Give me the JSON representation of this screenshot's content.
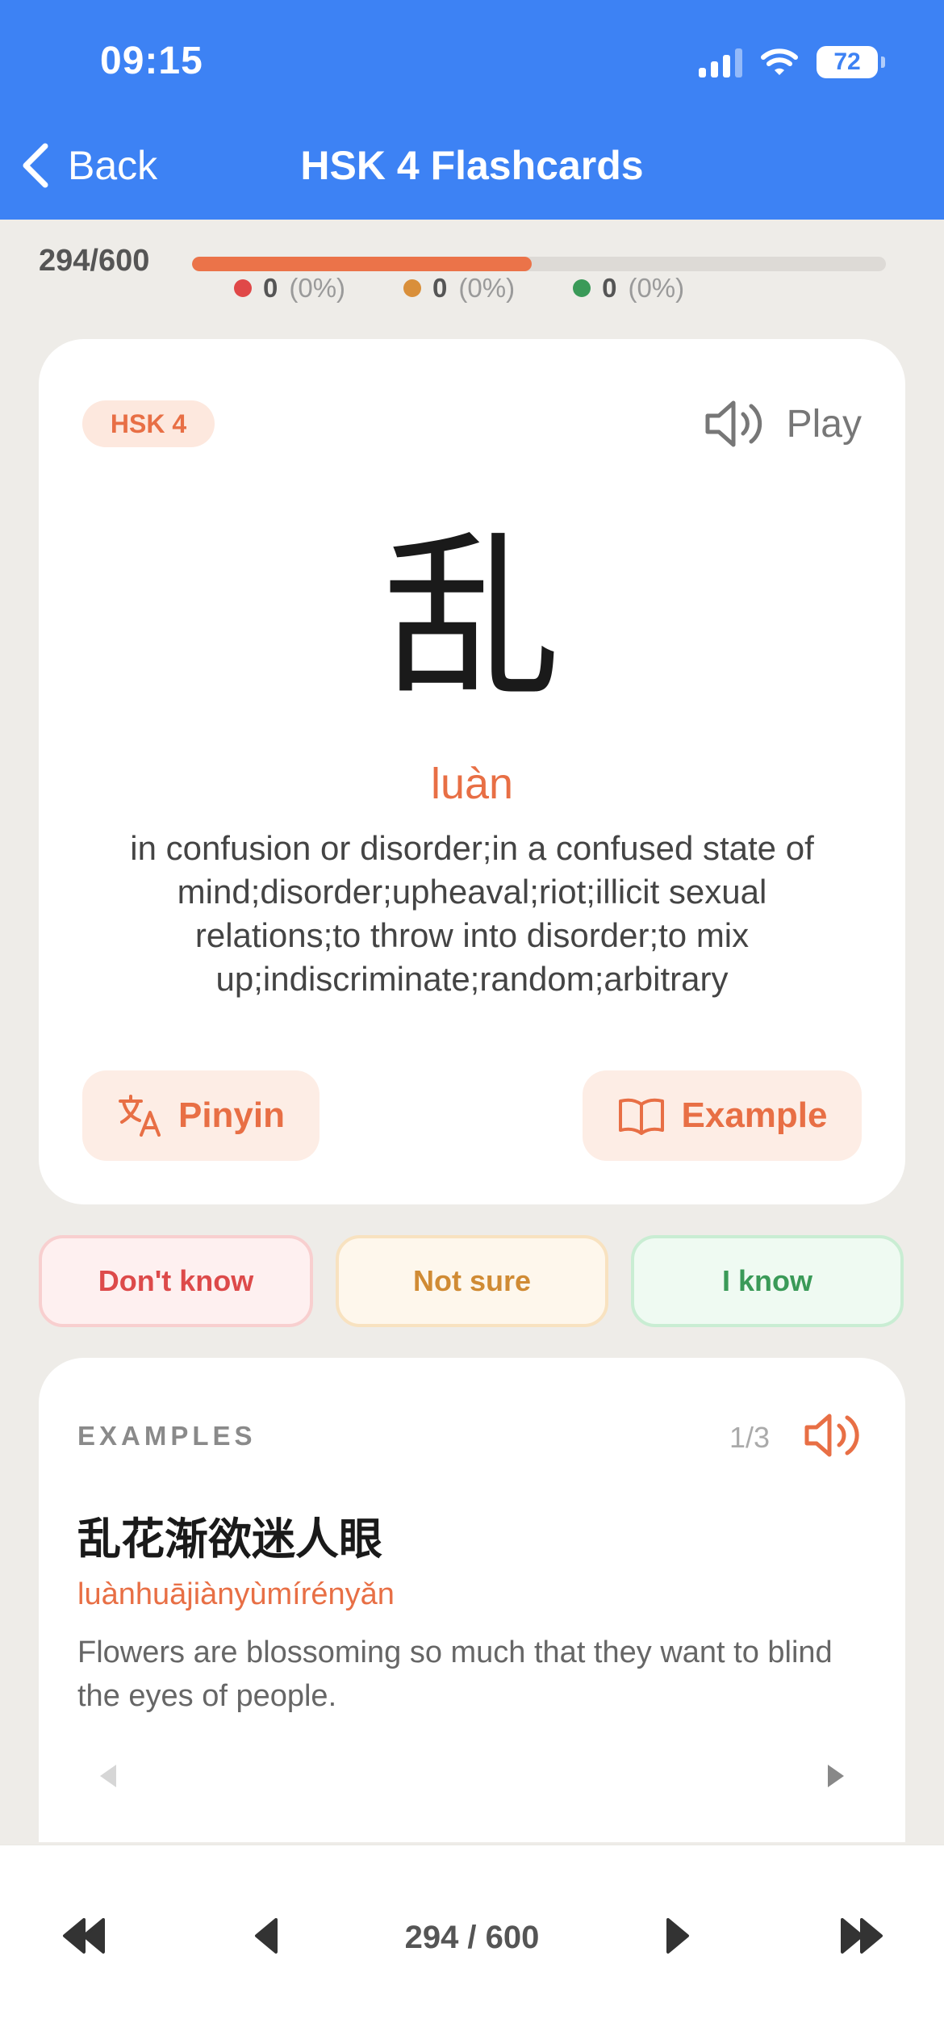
{
  "status_bar": {
    "time": "09:15",
    "battery": "72"
  },
  "header": {
    "back_label": "Back",
    "title": "HSK 4 Flashcards"
  },
  "progress": {
    "position_label": "294/600",
    "fraction": 0.49,
    "stats": [
      {
        "count": "0",
        "percent": "(0%)",
        "color": "#E04848"
      },
      {
        "count": "0",
        "percent": "(0%)",
        "color": "#D98F3A"
      },
      {
        "count": "0",
        "percent": "(0%)",
        "color": "#3A9A58"
      }
    ]
  },
  "card": {
    "level": "HSK 4",
    "play_label": "Play",
    "hanzi": "乱",
    "pinyin": "luàn",
    "meaning": "in confusion or disorder;in a confused state of mind;disorder;upheaval;riot;illicit sexual relations;to throw into disorder;to mix up;indiscriminate;random;arbitrary",
    "pinyin_button": "Pinyin",
    "example_button": "Example"
  },
  "answers": {
    "dont_know": "Don't know",
    "not_sure": "Not sure",
    "know": "I know"
  },
  "examples": {
    "label": "EXAMPLES",
    "counter": "1/3",
    "hanzi": "乱花渐欲迷人眼",
    "pinyin": "luànhuājiànyùmírényǎn",
    "translation": "Flowers are blossoming so much that they want to blind the eyes of people."
  },
  "bottom_bar": {
    "counter": "294 / 600"
  },
  "colors": {
    "header": "#3D82F4",
    "accent": "#EB7349"
  }
}
